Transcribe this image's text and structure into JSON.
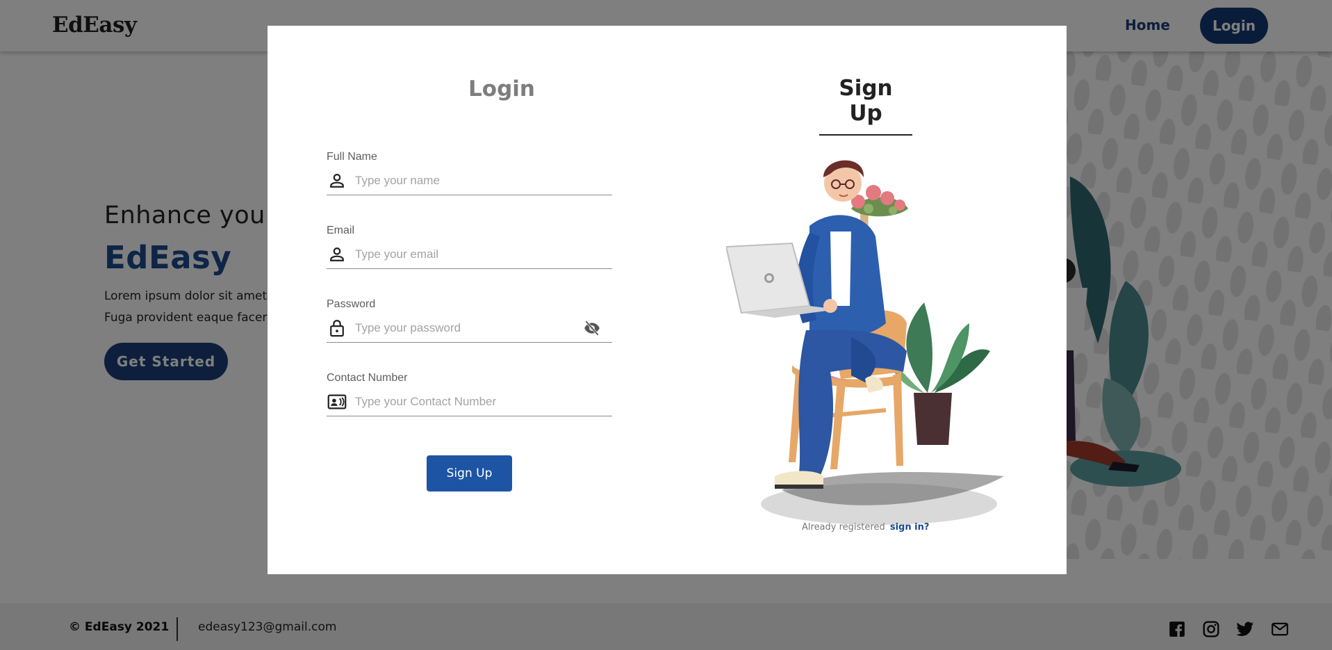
{
  "navbar": {
    "brand": "EdEasy",
    "home_label": "Home",
    "login_label": "Login"
  },
  "hero": {
    "line1": "Enhance your",
    "brand": "EdEasy",
    "paragraph_line1": "Lorem ipsum dolor sit amet",
    "paragraph_line2": "Fuga provident eaque facere",
    "cta_label": "Get Started"
  },
  "footer": {
    "copyright": "© EdEasy 2021",
    "email": "edeasy123@gmail.com",
    "social_icons": [
      "facebook-icon",
      "instagram-icon",
      "twitter-icon",
      "mail-icon"
    ]
  },
  "modal": {
    "tab_login": "Login",
    "tab_signup": "Sign Up",
    "fields": [
      {
        "label": "Full Name",
        "placeholder": "Type your name",
        "icon": "user-icon"
      },
      {
        "label": "Email",
        "placeholder": "Type your email",
        "icon": "user-icon"
      },
      {
        "label": "Password",
        "placeholder": "Type your password",
        "icon": "lock-icon"
      },
      {
        "label": "Contact Number",
        "placeholder": "Type your Contact Number",
        "icon": "contact-card-icon"
      }
    ],
    "submit_label": "Sign Up",
    "already_text": "Already registered",
    "signin_link": "sign in?"
  },
  "colors": {
    "primary": "#1d55a4",
    "navy": "#123a76",
    "overlay": "rgba(0,0,0,0.5)"
  }
}
